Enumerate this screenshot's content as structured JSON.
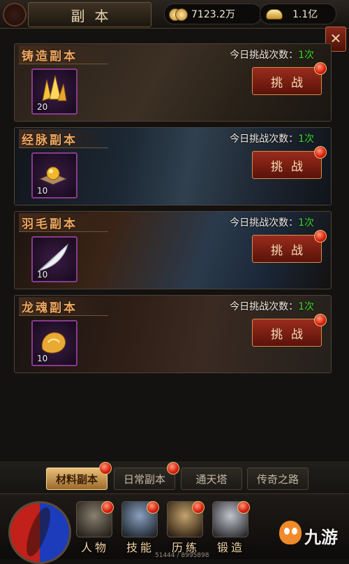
{
  "header": {
    "title": "副本",
    "gold_value": "7123.2万",
    "ingot_value": "1.1亿",
    "close_label": "✕"
  },
  "dungeons": [
    {
      "name": "铸造副本",
      "count_label": "今日挑战次数：",
      "count_value": "1次",
      "item_qty": "20",
      "button_label": "挑战",
      "item_icon": "gold-crystal-icon"
    },
    {
      "name": "经脉副本",
      "count_label": "今日挑战次数：",
      "count_value": "1次",
      "item_qty": "10",
      "button_label": "挑战",
      "item_icon": "golden-orb-icon"
    },
    {
      "name": "羽毛副本",
      "count_label": "今日挑战次数：",
      "count_value": "1次",
      "item_qty": "10",
      "button_label": "挑战",
      "item_icon": "white-feather-icon"
    },
    {
      "name": "龙魂副本",
      "count_label": "今日挑战次数：",
      "count_value": "1次",
      "item_qty": "10",
      "button_label": "挑战",
      "item_icon": "dragon-soul-icon"
    }
  ],
  "tabs": [
    {
      "label": "材料副本",
      "active": true
    },
    {
      "label": "日常副本",
      "active": false
    },
    {
      "label": "通天塔",
      "active": false
    },
    {
      "label": "传奇之路",
      "active": false
    }
  ],
  "nav": [
    {
      "label": "人物",
      "icon": "character-icon"
    },
    {
      "label": "技能",
      "icon": "skill-book-icon"
    },
    {
      "label": "历练",
      "icon": "training-icon"
    },
    {
      "label": "锻造",
      "icon": "forge-icon"
    }
  ],
  "footer_text": "51444 / 8995898",
  "watermark": "九游",
  "colors": {
    "count_green": "#3fdc2c",
    "name_orange": "#f0a860",
    "button_red": "#9a2c1c",
    "item_border_purple": "#8a3a8e"
  }
}
